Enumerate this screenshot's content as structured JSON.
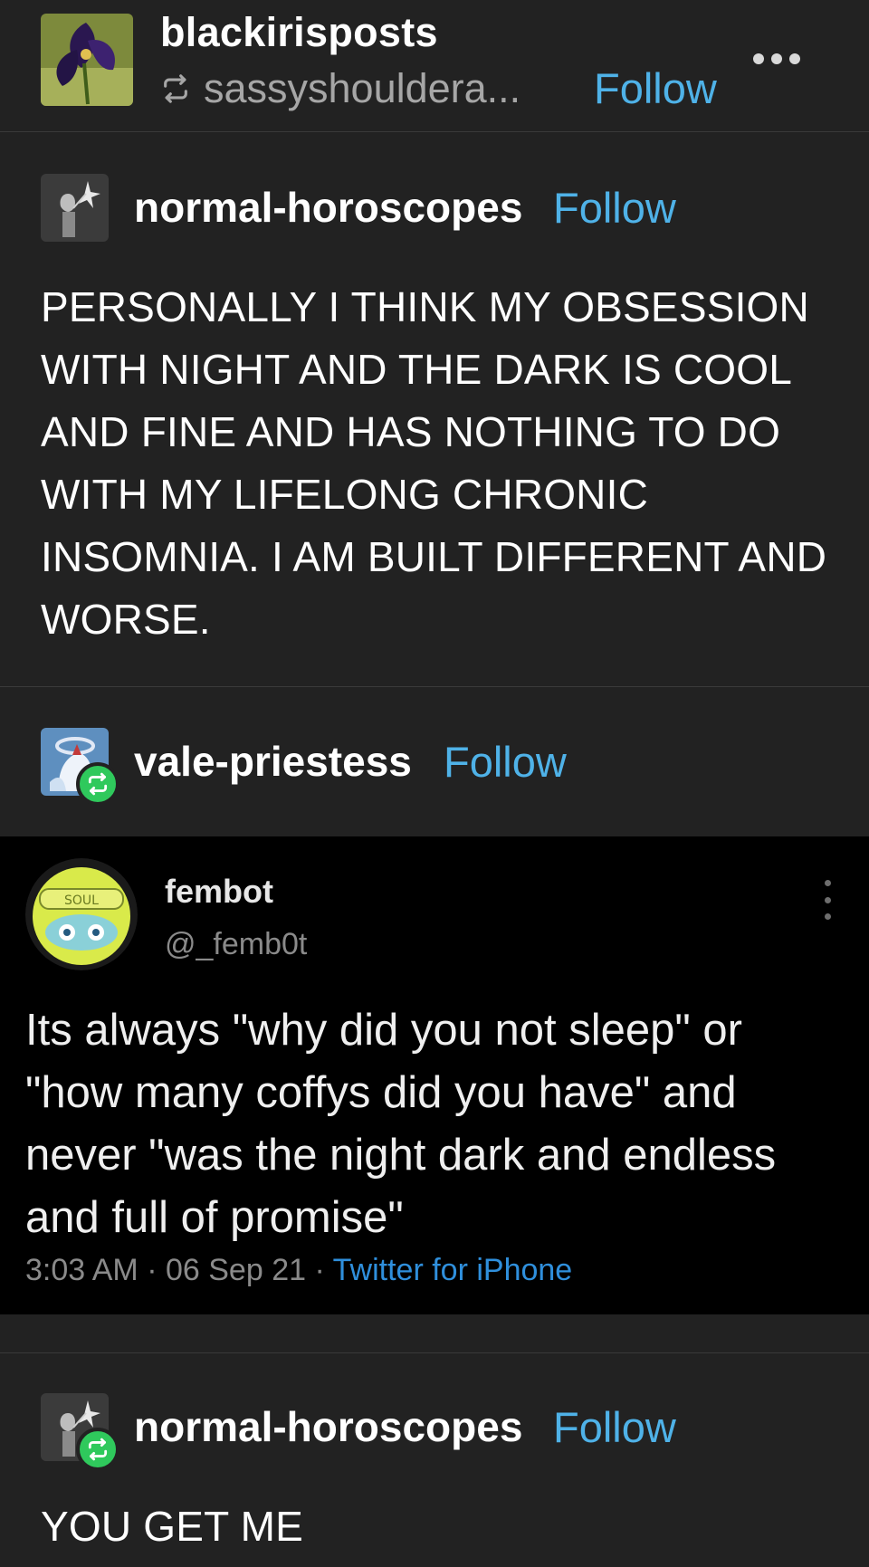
{
  "header": {
    "name": "blackirisposts",
    "reblogged_from": "sassyshouldera...",
    "follow_label": "Follow"
  },
  "posts": [
    {
      "name": "normal-horoscopes",
      "follow_label": "Follow",
      "text": "PERSONALLY I THINK MY OBSESSION WITH NIGHT AND THE DARK IS COOL AND FINE AND HAS NOTHING TO DO WITH MY LIFELONG CHRONIC INSOMNIA. I AM BUILT DIFFERENT AND WORSE."
    },
    {
      "name": "vale-priestess",
      "follow_label": "Follow"
    },
    {
      "name": "normal-horoscopes",
      "follow_label": "Follow",
      "text": "YOU GET ME"
    }
  ],
  "tweet": {
    "avatar_text": "SOUL",
    "name": "fembot",
    "handle": "@_femb0t",
    "text": "Its always \"why did you not sleep\" or \"how many coffys did you have\" and never \"was the night dark and endless and full of promise\"",
    "time": "3:03 AM",
    "date": "06 Sep 21",
    "separator": "·",
    "source": "Twitter for iPhone"
  },
  "colors": {
    "background": "#222222",
    "link": "#4fb2e8",
    "reblog_badge": "#2fc95c",
    "tweet_background": "#000000",
    "tweet_source": "#2f8fdc"
  },
  "icons": [
    "reblog-icon",
    "more-icon",
    "reblog-badge-icon",
    "tweet-more-icon"
  ]
}
